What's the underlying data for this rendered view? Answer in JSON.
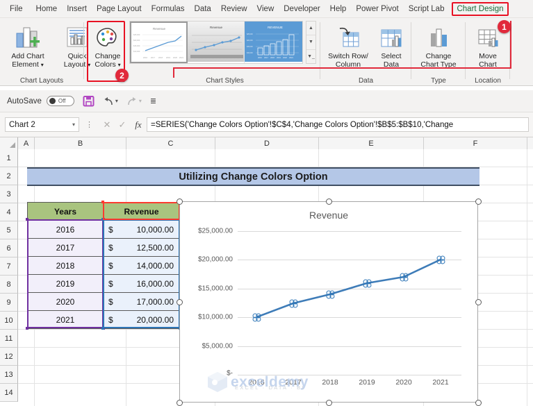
{
  "ribbon_tabs": [
    {
      "label": "File",
      "active": false
    },
    {
      "label": "Home",
      "active": false
    },
    {
      "label": "Insert",
      "active": false
    },
    {
      "label": "Page Layout",
      "active": false
    },
    {
      "label": "Formulas",
      "active": false
    },
    {
      "label": "Data",
      "active": false
    },
    {
      "label": "Review",
      "active": false
    },
    {
      "label": "View",
      "active": false
    },
    {
      "label": "Developer",
      "active": false
    },
    {
      "label": "Help",
      "active": false
    },
    {
      "label": "Power Pivot",
      "active": false
    },
    {
      "label": "Script Lab",
      "active": false
    },
    {
      "label": "Chart Design",
      "active": true
    }
  ],
  "ribbon": {
    "groups": [
      {
        "name": "Chart Layouts",
        "label": "Chart Layouts"
      },
      {
        "name": "Chart Styles",
        "label": "Chart Styles"
      },
      {
        "name": "Data",
        "label": "Data"
      },
      {
        "name": "Type",
        "label": "Type"
      },
      {
        "name": "Location",
        "label": "Location"
      }
    ],
    "buttons": {
      "add_chart_element_line1": "Add Chart",
      "add_chart_element_line2": "Element",
      "quick_layout_line1": "Quick",
      "quick_layout_line2": "Layout",
      "change_colors_line1": "Change",
      "change_colors_line2": "Colors",
      "switch_row_column_line1": "Switch Row/",
      "switch_row_column_line2": "Column",
      "select_data_line1": "Select",
      "select_data_line2": "Data",
      "change_chart_type_line1": "Change",
      "change_chart_type_line2": "Chart Type",
      "move_chart_line1": "Move",
      "move_chart_line2": "Chart"
    }
  },
  "annotations": [
    {
      "number": "1",
      "target": "chart-design-tab"
    },
    {
      "number": "2",
      "target": "change-colors-button"
    }
  ],
  "quick_access": {
    "autosave_label": "AutoSave",
    "autosave_state": "Off",
    "save_icon": "save-icon",
    "undo_icon": "undo-icon",
    "redo_icon": "redo-icon",
    "customize_icon": "customize-toolbar-icon"
  },
  "formula_bar": {
    "name_box_value": "Chart 2",
    "cancel_icon": "cancel-icon",
    "enter_icon": "confirm-icon",
    "function_icon": "insert-function-icon",
    "formula": "=SERIES('Change Colors Option'!$C$4,'Change Colors Option'!$B$5:$B$10,'Change"
  },
  "grid": {
    "columns": [
      "A",
      "B",
      "C",
      "D",
      "E",
      "F"
    ],
    "rows": [
      "1",
      "2",
      "3",
      "4",
      "5",
      "6",
      "7",
      "8",
      "9",
      "10",
      "11",
      "12",
      "13",
      "14"
    ]
  },
  "sheet": {
    "banner_title": "Utilizing Change Colors Option",
    "table": {
      "headers": [
        "Years",
        "Revenue"
      ],
      "rows": [
        {
          "year": "2016",
          "currency": "$",
          "amount": "10,000.00"
        },
        {
          "year": "2017",
          "currency": "$",
          "amount": "12,500.00"
        },
        {
          "year": "2018",
          "currency": "$",
          "amount": "14,000.00"
        },
        {
          "year": "2019",
          "currency": "$",
          "amount": "16,000.00"
        },
        {
          "year": "2020",
          "currency": "$",
          "amount": "17,000.00"
        },
        {
          "year": "2021",
          "currency": "$",
          "amount": "20,000.00"
        }
      ]
    },
    "watermark": {
      "text": "exceldemy",
      "subtitle": "EXCEL · DATA · BI"
    }
  },
  "chart_data": {
    "type": "line",
    "title": "Revenue",
    "xlabel": "",
    "ylabel": "",
    "categories": [
      "2016",
      "2017",
      "2018",
      "2019",
      "2020",
      "2021"
    ],
    "series": [
      {
        "name": "Revenue",
        "values": [
          10000,
          12500,
          14000,
          16000,
          17000,
          20000
        ],
        "color": "#3E7CB8"
      }
    ],
    "ytick_labels": [
      "$25,000.00",
      "$20,000.00",
      "$15,000.00",
      "$10,000.00",
      "$5,000.00",
      "$-"
    ],
    "ytick_values": [
      25000,
      20000,
      15000,
      10000,
      5000,
      0
    ],
    "ylim": [
      0,
      25000
    ],
    "grid": true,
    "legend": "none",
    "marker": "open-circle",
    "selected": true
  },
  "colors": {
    "accent_red": "#e81123",
    "badge_red": "#e1293b",
    "series_blue": "#3E7CB8",
    "banner_blue": "#b4c7e7",
    "header_green": "#a9c47f",
    "tab_active_green": "#1b6b3a",
    "selection_purple": "#7030a0",
    "selection_blue": "#2e75b6"
  }
}
